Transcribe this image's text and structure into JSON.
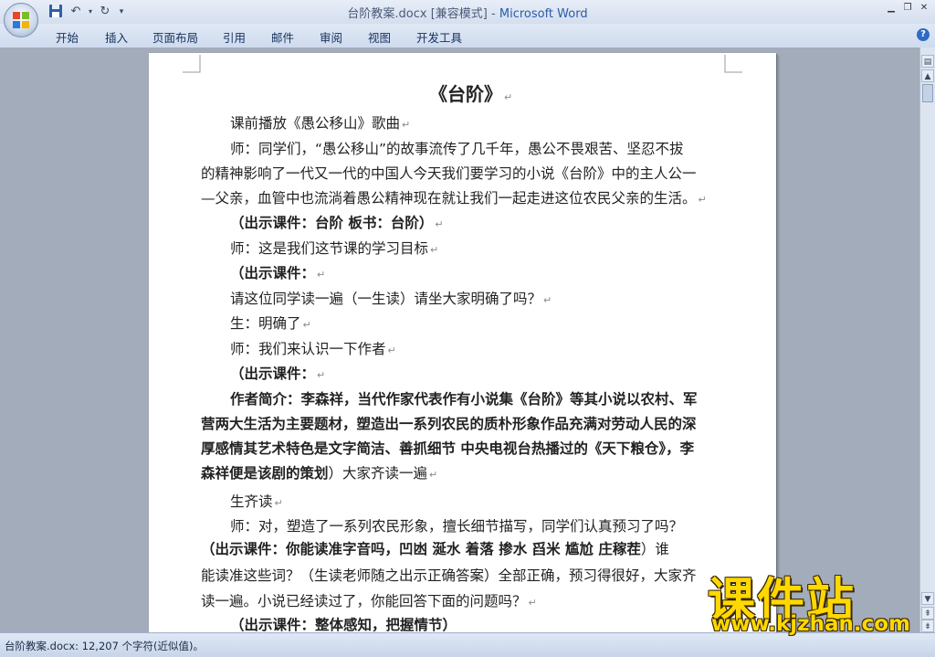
{
  "window": {
    "doc_name": "台阶教案.docx [兼容模式]",
    "separator": " - ",
    "app_name": "Microsoft Word"
  },
  "ribbon": {
    "tabs": [
      "开始",
      "插入",
      "页面布局",
      "引用",
      "邮件",
      "审阅",
      "视图",
      "开发工具"
    ]
  },
  "document": {
    "lines": [
      {
        "text": "《台阶》",
        "bold": true,
        "kind": "title",
        "mark": "↵"
      },
      {
        "text": "课前播放《愚公移山》歌曲",
        "mark": "↵"
      },
      {
        "text": "师：同学们，“愚公移山”的故事流传了几千年，愚公不畏艰苦、坚忍不拔"
      },
      {
        "text": "的精神影响了一代又一代的中国人今天我们要学习的小说《台阶》中的主人公一"
      },
      {
        "text": "—父亲，血管中也流淌着愚公精神现在就让我们一起走进这位农民父亲的生活。",
        "mark": "↵"
      },
      {
        "text": "（出示课件：台阶 板书：台阶）",
        "bold": true,
        "mark": "↵"
      },
      {
        "text": "师：这是我们这节课的学习目标",
        "mark": "↵"
      },
      {
        "text": "（出示课件：",
        "bold": true,
        "mark": "↵"
      },
      {
        "text": "请这位同学读一遍（一生读）请坐大家明确了吗？",
        "mark": "↵"
      },
      {
        "text": "生：明确了",
        "mark": "↵"
      },
      {
        "text": "师：我们来认识一下作者",
        "mark": "↵"
      },
      {
        "text": "（出示课件：",
        "bold": true,
        "mark": "↵"
      },
      {
        "text": "作者简介：李森祥，当代作家代表作有小说集《台阶》等其小说以农村、军",
        "bold": true
      },
      {
        "text": "营两大生活为主要题材，塑造出一系列农民的质朴形象作品充满对劳动人民的深",
        "bold": true
      },
      {
        "text": "厚感情其艺术特色是文字简洁、善抓细节 中央电视台热播过的《天下粮仓》，李",
        "bold": true
      },
      {
        "text": "森祥便是该剧的策划",
        "bold": true,
        "tail": "）大家齐读一遍",
        "mark": "↵"
      },
      {
        "text": "生齐读",
        "mark": "↵"
      },
      {
        "text": "师：对，塑造了一系列农民形象，擅长细节描写，同学们认真预习了吗？"
      },
      {
        "text": "（出示课件：你能读准字音吗，凹凼  涎水 着落  掺水  舀米    尴尬   庄稼茬",
        "bold": true,
        "tail": "）谁"
      },
      {
        "text": "能读准这些词？（生读老师随之出示正确答案）全部正确，预习得很好，大家齐"
      },
      {
        "text": "读一遍。小说已经读过了，你能回答下面的问题吗？",
        "mark": "↵"
      },
      {
        "text": "（出示课件：整体感知，把握情节）",
        "bold": true
      }
    ]
  },
  "status": {
    "text": "台阶教案.docx: 12,207 个字符(近似值)。"
  },
  "watermark": {
    "title": "课件站",
    "url": "www.kjzhan.com"
  },
  "colors": {
    "accent": "#2a5ca8",
    "workspace": "#a3acba",
    "watermark": "#ffd800"
  }
}
